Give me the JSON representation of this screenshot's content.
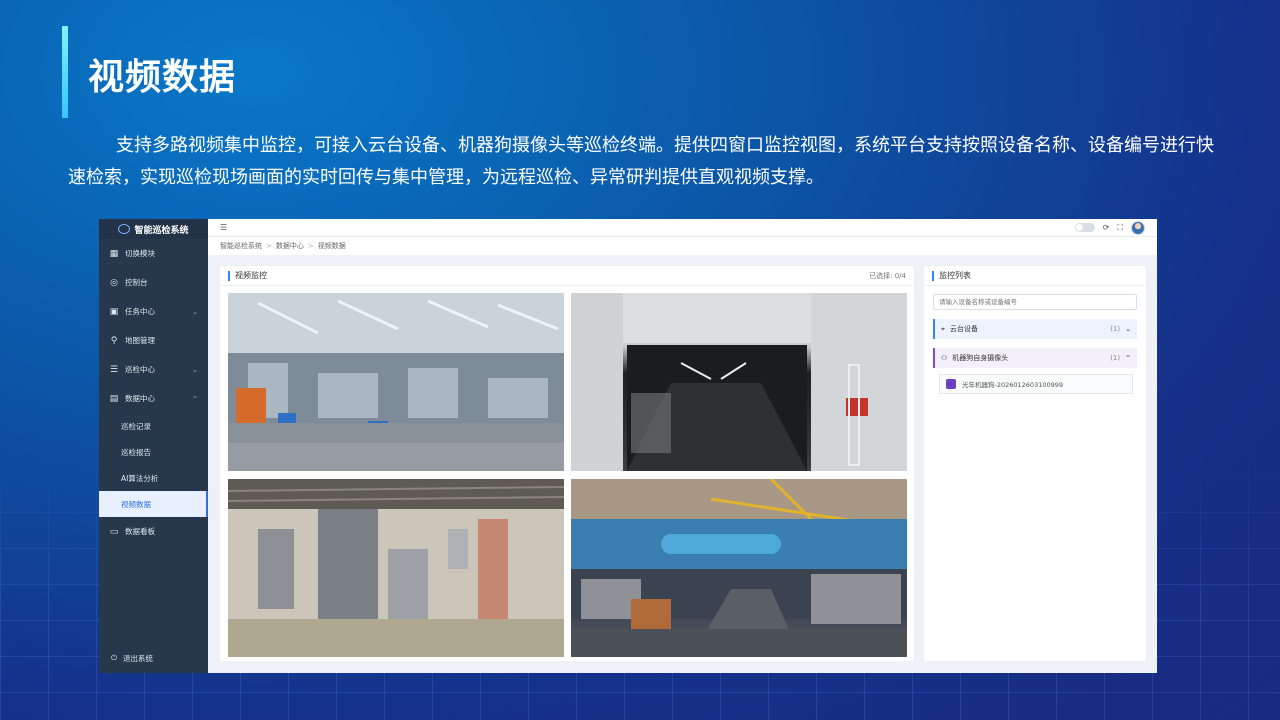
{
  "slide": {
    "title": "视频数据",
    "intro": "支持多路视频集中监控，可接入云台设备、机器狗摄像头等巡检终端。提供四窗口监控视图，系统平台支持按照设备名称、设备编号进行快速检索，实现巡检现场画面的实时回传与集中管理，为远程巡检、异常研判提供直观视频支撑。"
  },
  "app": {
    "brand": "智能巡检系统",
    "sidebar": {
      "items": [
        {
          "label": "切换模块",
          "icon": "grid-icon"
        },
        {
          "label": "控制台",
          "icon": "dashboard-icon"
        },
        {
          "label": "任务中心",
          "icon": "calendar-icon"
        },
        {
          "label": "地图管理",
          "icon": "map-pin-icon"
        },
        {
          "label": "巡检中心",
          "icon": "list-icon"
        },
        {
          "label": "数据中心",
          "icon": "chart-icon"
        }
      ],
      "sub_items": [
        "巡检记录",
        "巡检报告",
        "AI算法分析",
        "视频数据"
      ],
      "board": "数据看板",
      "logout": "退出系统"
    },
    "breadcrumb": [
      "智能巡检系统",
      "数据中心",
      "视频数据"
    ],
    "video_panel": {
      "title": "视频监控",
      "selected": "已选择: 0/4",
      "feeds": [
        "factory-floor",
        "storage-tunnel",
        "electrical-room",
        "workshop"
      ]
    },
    "monitor_panel": {
      "title": "监控列表",
      "search_placeholder": "请输入设备名称或设备编号",
      "groups": [
        {
          "label": "云台设备",
          "count": "(1)"
        },
        {
          "label": "机器狗自身摄像头",
          "count": "(1)"
        }
      ],
      "device": "光年机器狗-2026012603100999"
    }
  }
}
